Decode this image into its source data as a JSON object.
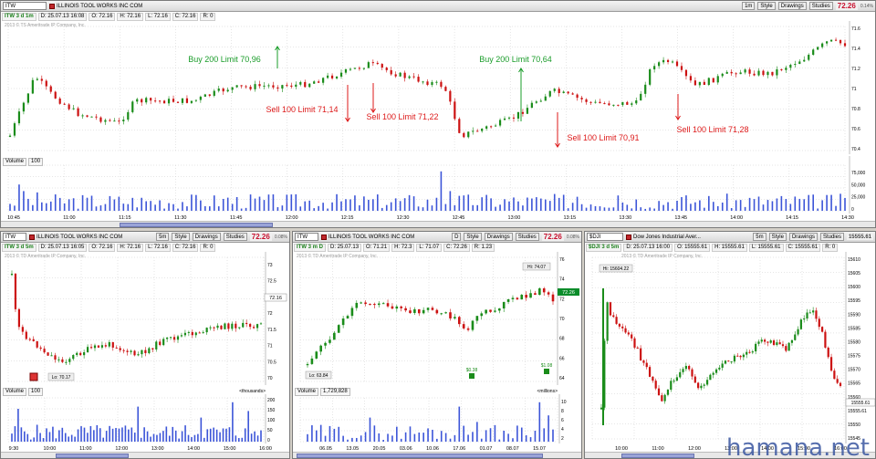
{
  "top": {
    "symbol": "ITW",
    "company": "ILLINOIS TOOL WORKS INC COM",
    "interval": "1m",
    "style": "Style",
    "drawings": "Drawings",
    "studies": "Studies",
    "last": "72.26",
    "pct": "0.14%",
    "ohlc": {
      "sym": "ITW 3 d 1m",
      "d": "D: 25.07.13 16:08",
      "o": "O: 72.16",
      "h": "H: 72.16",
      "l": "L: 72.16",
      "c": "C: 72.16",
      "r": "R: 0"
    },
    "copyright": "2013 © TS Ameritrade IP Company, Inc.",
    "volume_label": "Volume",
    "volume_value": "100",
    "price_axis": [
      "71.6",
      "71.4",
      "71.2",
      "71",
      "70.8",
      "70.6",
      "70.4"
    ],
    "volume_axis": [
      "75,000",
      "50,000",
      "25,000",
      "0"
    ],
    "time_axis": [
      "10:45",
      "11:00",
      "11:15",
      "11:30",
      "11:45",
      "12:00",
      "12:15",
      "12:30",
      "12:45",
      "13:00",
      "13:15",
      "13:30",
      "13:45",
      "14:00",
      "14:15",
      "14:30"
    ],
    "orders": [
      {
        "text": "Buy 200 Limit 70,96",
        "type": "buy"
      },
      {
        "text": "Sell 100 Limit 71,14",
        "type": "sell"
      },
      {
        "text": "Sell 100 Limit 71,22",
        "type": "sell"
      },
      {
        "text": "Buy 200 Limit 70,64",
        "type": "buy"
      },
      {
        "text": "Sell 100 Limit 70,91",
        "type": "sell"
      },
      {
        "text": "Sell 100 Limit 71,28",
        "type": "sell"
      }
    ]
  },
  "left": {
    "symbol": "ITW",
    "company": "ILLINOIS TOOL WORKS INC COM",
    "interval": "5m",
    "style": "Style",
    "drawings": "Drawings",
    "studies": "Studies",
    "last": "72.26",
    "pct": "0.08%",
    "ohlc": {
      "sym": "ITW 3 d 5m",
      "d": "D: 25.07.13 16:05",
      "o": "O: 72.16",
      "h": "H: 72.16",
      "l": "L: 72.16",
      "c": "C: 72.16",
      "r": "R: 0"
    },
    "copyright": "2013 © TD Ameritrade IP Company, Inc.",
    "volume_label": "Volume",
    "volume_value": "100",
    "unit": "<thousands>",
    "price_axis": [
      "73",
      "72.5",
      "72.16",
      "72",
      "71.5",
      "71",
      "70.5",
      "70"
    ],
    "volume_axis": [
      "200",
      "150",
      "100",
      "50",
      "0"
    ],
    "time_axis": [
      "9:30",
      "10:00",
      "11:00",
      "12:00",
      "13:00",
      "14:00",
      "15:00",
      "16:00"
    ],
    "low_label": "Lo: 70.17"
  },
  "middle": {
    "symbol": "ITW",
    "company": "ILLINOIS TOOL WORKS INC COM",
    "interval": "D",
    "style": "Style",
    "drawings": "Drawings",
    "studies": "Studies",
    "last": "72.26",
    "pct": "0.08%",
    "ohlc": {
      "sym": "ITW 3 m D",
      "d": "D: 25.07.13",
      "o": "O: 71.21",
      "h": "H: 72.3",
      "l": "L: 71.07",
      "c": "C: 72.26",
      "r": "R: 1.23"
    },
    "copyright": "2013 © TD Ameritrade IP Company, Inc.",
    "volume_label": "Volume",
    "volume_value": "1,729,828",
    "unit": "<millions>",
    "price_axis": [
      "76",
      "74",
      "72",
      "70",
      "68",
      "66",
      "64"
    ],
    "price_tag": "72.26",
    "volume_axis": [
      "10",
      "8",
      "6",
      "4",
      "2"
    ],
    "time_axis": [
      "06.05",
      "13.05",
      "20.05",
      "03.06",
      "10.06",
      "17.06",
      "01.07",
      "08.07",
      "15.07"
    ],
    "hi_label": "Hi: 74.07",
    "low_label": "Lo: 63.84",
    "div1": "$0.38",
    "div2": "$1.08"
  },
  "right": {
    "symbol": "$DJI",
    "company": "Dow Jones Industrial Aver...",
    "interval": "5m",
    "style": "Style",
    "drawings": "Drawings",
    "studies": "Studies",
    "last": "15555.61",
    "ohlc": {
      "sym": "$DJI 3 d 5m",
      "d": "D: 25.07.13 16:00",
      "o": "O: 15555.61",
      "h": "H: 15555.61",
      "l": "L: 15555.61",
      "c": "C: 15555.61",
      "r": "R: 0"
    },
    "copyright": "2013 © TD Ameritrade IP Company, Inc.",
    "price_axis": [
      "15610",
      "15605",
      "15600",
      "15595",
      "15590",
      "15585",
      "15580",
      "15575",
      "15570",
      "15565",
      "15560",
      "15555.61",
      "15550",
      "15545"
    ],
    "price_tag": "15555.61",
    "time_axis": [
      "10:00",
      "11:00",
      "12:00",
      "13:00",
      "14:00",
      "15:00",
      "16:00"
    ],
    "hi_label": "Hi: 15604.22"
  },
  "watermark": "hamana.net"
}
